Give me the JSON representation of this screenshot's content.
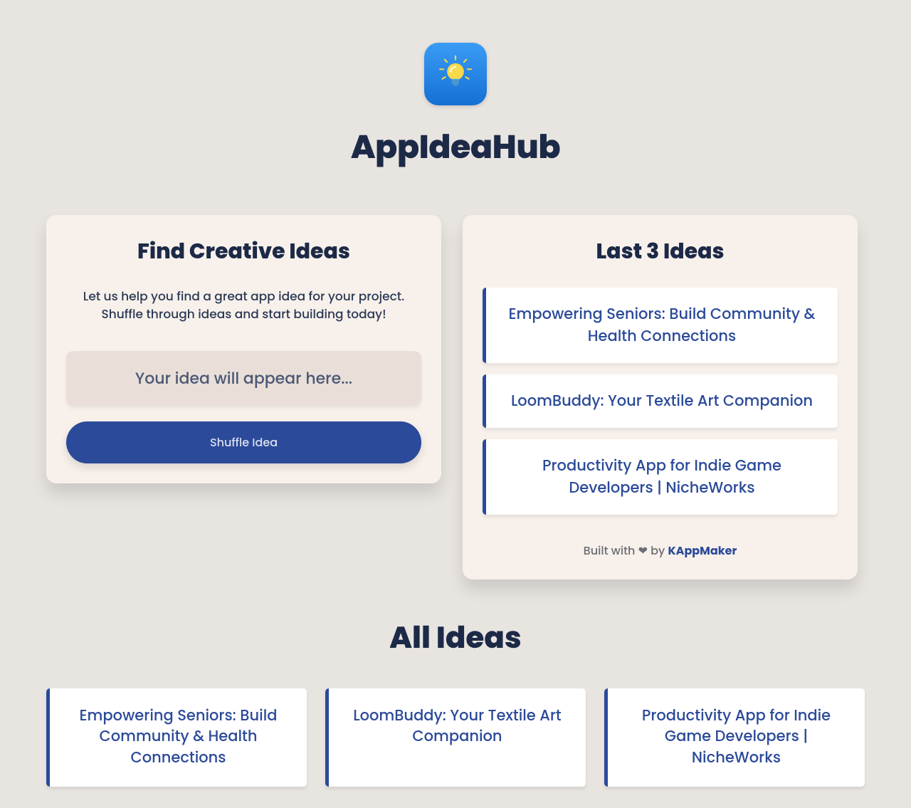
{
  "header": {
    "title": "AppIdeaHub"
  },
  "find": {
    "title": "Find Creative Ideas",
    "subtitle": "Let us help you find a great app idea for your project. Shuffle through ideas and start building today!",
    "placeholder": "Your idea will appear here...",
    "shuffle_label": "Shuffle Idea"
  },
  "last": {
    "title": "Last 3 Ideas",
    "items": [
      "Empowering Seniors: Build Community & Health Connections",
      "LoomBuddy: Your Textile Art Companion",
      "Productivity App for Indie Game Developers | NicheWorks"
    ],
    "credit_prefix": "Built with ❤ by ",
    "credit_link": "KAppMaker"
  },
  "all": {
    "title": "All Ideas",
    "items": [
      "Empowering Seniors: Build Community & Health Connections",
      "LoomBuddy: Your Textile Art Companion",
      "Productivity App for Indie Game Developers | NicheWorks"
    ]
  }
}
